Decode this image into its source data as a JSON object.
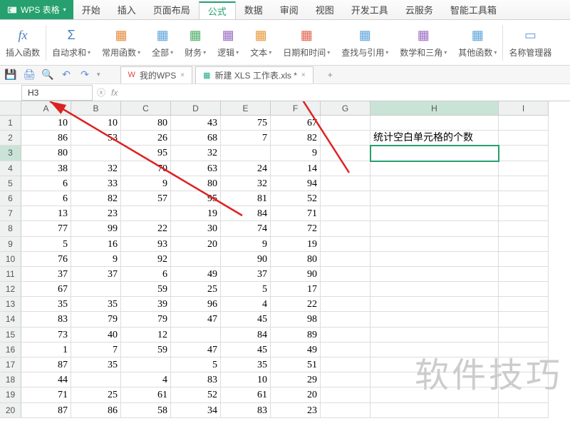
{
  "app": {
    "name": "WPS 表格"
  },
  "menu": {
    "items": [
      "开始",
      "插入",
      "页面布局",
      "公式",
      "数据",
      "审阅",
      "视图",
      "开发工具",
      "云服务",
      "智能工具箱"
    ],
    "active": 3
  },
  "ribbon": [
    {
      "label": "插入函数",
      "icon": "fx",
      "color": "#4a7fbf",
      "dd": false
    },
    {
      "label": "自动求和",
      "icon": "Σ",
      "color": "#4a7fbf",
      "dd": true
    },
    {
      "label": "常用函数",
      "icon": "▦",
      "color": "#e68a3d",
      "dd": true
    },
    {
      "label": "全部",
      "icon": "▦",
      "color": "#5ea5dc",
      "dd": true
    },
    {
      "label": "财务",
      "icon": "▦",
      "color": "#4fb06a",
      "dd": true
    },
    {
      "label": "逻辑",
      "icon": "▦",
      "color": "#9b6fc6",
      "dd": true
    },
    {
      "label": "文本",
      "icon": "▦",
      "color": "#e89a3c",
      "dd": true
    },
    {
      "label": "日期和时间",
      "icon": "▦",
      "color": "#e0644e",
      "dd": true
    },
    {
      "label": "查找与引用",
      "icon": "▦",
      "color": "#5ea5dc",
      "dd": true
    },
    {
      "label": "数学和三角",
      "icon": "▦",
      "color": "#9b6fc6",
      "dd": true
    },
    {
      "label": "其他函数",
      "icon": "▦",
      "color": "#5ea5dc",
      "dd": true
    },
    {
      "label": "名称管理器",
      "icon": "▭",
      "color": "#6a9ed4",
      "dd": false
    }
  ],
  "qat": [
    "save-icon",
    "print-icon",
    "preview-icon",
    "undo-icon",
    "redo-icon"
  ],
  "doc_tabs": [
    {
      "icon": "wps",
      "label": "我的WPS",
      "close": true
    },
    {
      "icon": "xls",
      "label": "新建 XLS 工作表.xls *",
      "close": true
    }
  ],
  "add_tab": "+",
  "name_box": "H3",
  "fx_label": "fx",
  "columns": [
    "A",
    "B",
    "C",
    "D",
    "E",
    "F",
    "G",
    "H",
    "I"
  ],
  "active_col": "H",
  "active_row": 3,
  "h2_text": "统计空白单元格的个数",
  "watermark": "软件技巧",
  "table": [
    [
      10,
      10,
      80,
      43,
      75,
      67
    ],
    [
      86,
      53,
      26,
      68,
      7,
      82
    ],
    [
      80,
      "",
      95,
      32,
      "",
      9
    ],
    [
      38,
      32,
      70,
      63,
      24,
      14
    ],
    [
      6,
      33,
      9,
      80,
      32,
      94
    ],
    [
      6,
      82,
      57,
      95,
      81,
      52
    ],
    [
      13,
      23,
      "",
      19,
      84,
      71
    ],
    [
      77,
      99,
      22,
      30,
      74,
      72
    ],
    [
      5,
      16,
      93,
      20,
      9,
      19
    ],
    [
      76,
      9,
      92,
      "",
      90,
      80
    ],
    [
      37,
      37,
      6,
      49,
      37,
      90
    ],
    [
      67,
      "",
      59,
      25,
      5,
      17
    ],
    [
      35,
      35,
      39,
      96,
      4,
      22
    ],
    [
      83,
      79,
      79,
      47,
      45,
      98
    ],
    [
      73,
      40,
      12,
      "",
      84,
      89
    ],
    [
      1,
      7,
      59,
      47,
      45,
      49
    ],
    [
      87,
      35,
      "",
      5,
      35,
      51
    ],
    [
      44,
      "",
      4,
      83,
      10,
      29
    ],
    [
      71,
      25,
      61,
      52,
      61,
      20
    ],
    [
      87,
      86,
      58,
      34,
      83,
      23
    ]
  ],
  "chart_data": {
    "type": "table",
    "title": "统计空白单元格的个数",
    "columns": [
      "A",
      "B",
      "C",
      "D",
      "E",
      "F"
    ],
    "rows": [
      [
        10,
        10,
        80,
        43,
        75,
        67
      ],
      [
        86,
        53,
        26,
        68,
        7,
        82
      ],
      [
        80,
        null,
        95,
        32,
        null,
        9
      ],
      [
        38,
        32,
        70,
        63,
        24,
        14
      ],
      [
        6,
        33,
        9,
        80,
        32,
        94
      ],
      [
        6,
        82,
        57,
        95,
        81,
        52
      ],
      [
        13,
        23,
        null,
        19,
        84,
        71
      ],
      [
        77,
        99,
        22,
        30,
        74,
        72
      ],
      [
        5,
        16,
        93,
        20,
        9,
        19
      ],
      [
        76,
        9,
        92,
        null,
        90,
        80
      ],
      [
        37,
        37,
        6,
        49,
        37,
        90
      ],
      [
        67,
        null,
        59,
        25,
        5,
        17
      ],
      [
        35,
        35,
        39,
        96,
        4,
        22
      ],
      [
        83,
        79,
        79,
        47,
        45,
        98
      ],
      [
        73,
        40,
        12,
        null,
        84,
        89
      ],
      [
        1,
        7,
        59,
        47,
        45,
        49
      ],
      [
        87,
        35,
        null,
        5,
        35,
        51
      ],
      [
        44,
        null,
        4,
        83,
        10,
        29
      ],
      [
        71,
        25,
        61,
        52,
        61,
        20
      ],
      [
        87,
        86,
        58,
        34,
        83,
        23
      ]
    ]
  }
}
